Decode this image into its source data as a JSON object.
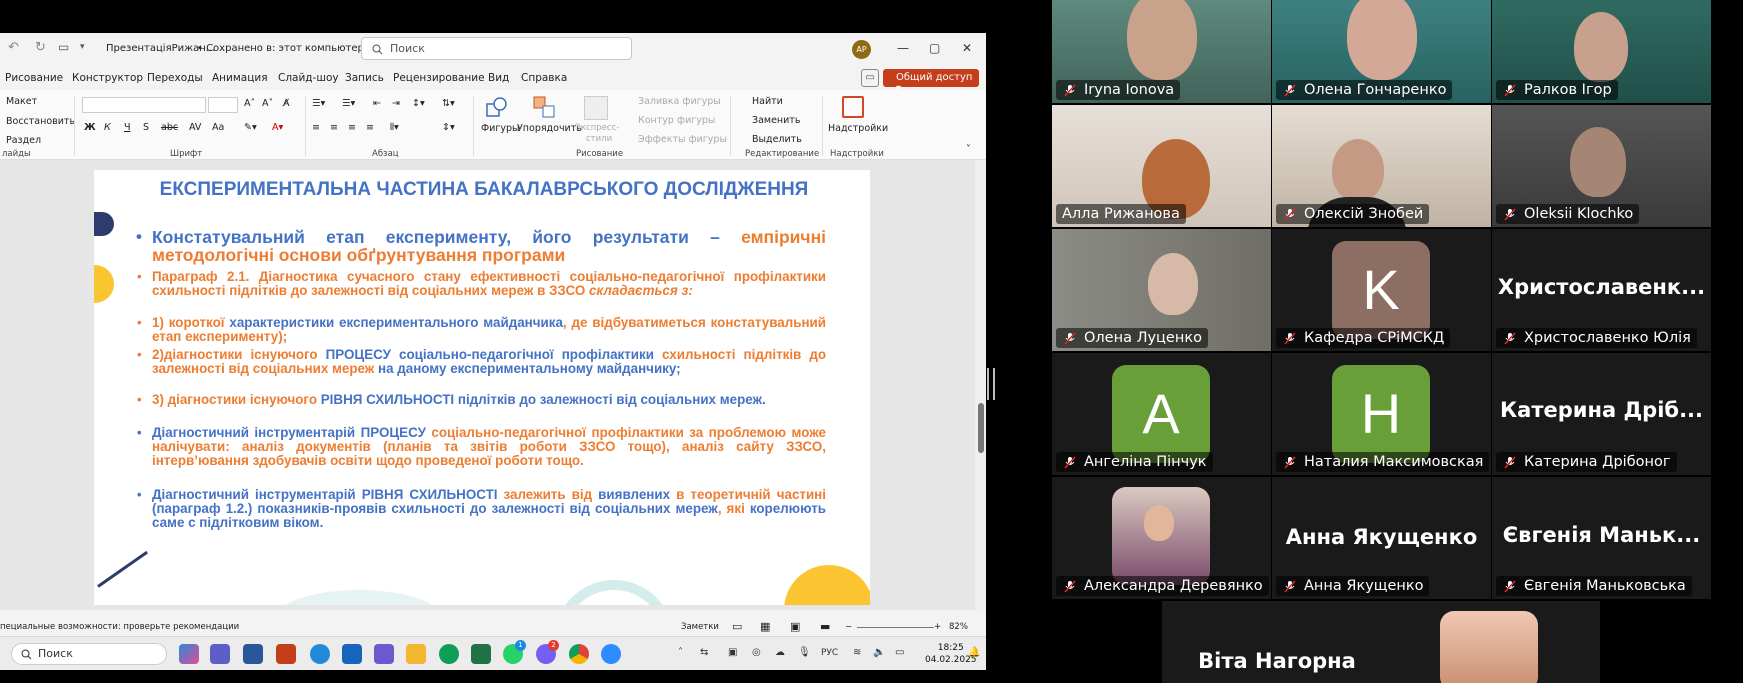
{
  "ppt": {
    "file_title": "ПрезентаціяРижан...",
    "save_status": "• Сохранено в: этот компьютер",
    "search_placeholder": "Поиск",
    "avatar_initials": "АР",
    "menu": [
      "Рисование",
      "Конструктор",
      "Переходы",
      "Анимация",
      "Слайд-шоу",
      "Запись",
      "Рецензирование",
      "Вид",
      "Справка"
    ],
    "share_label": "Общий доступ",
    "ribbon": {
      "layout": "Макет",
      "reset": "Восстановить",
      "section": "Раздел",
      "slides_group": "лайды",
      "font_group": "Шрифт",
      "paragraph_group": "Абзац",
      "shapes": "Фигуры",
      "arrange": "Упорядочить",
      "express_styles_1": "Экспресс-",
      "express_styles_2": "стили",
      "shape_fill": "Заливка фигуры",
      "shape_outline": "Контур фигуры",
      "shape_effects": "Эффекты фигуры",
      "drawing_group": "Рисование",
      "find": "Найти",
      "replace": "Заменить",
      "select": "Выделить",
      "editing_group": "Редактирование",
      "addins": "Надстройки",
      "addins_group": "Надстройки"
    },
    "slide": {
      "title": "ЕКСПЕРИМЕНТАЛЬНА ЧАСТИНА БАКАЛАВРСЬКОГО ДОСЛІДЖЕННЯ",
      "main_blue": "Констатувальний етап експерименту, його результати – ",
      "main_orange": "емпіричні методологічні основи обґрунтування програми",
      "p1_text": "Параграф 2.1. Діагностика сучасного стану ефективності соціально-педагогічної профілактики схильності підлітків до залежності від соціальних мереж в ЗЗСО ",
      "p1_italic": "складається з:",
      "p2_a": "1) короткої ",
      "p2_b": "характеристики експериментального майданчика",
      "p2_c": ", де відбуватиметься констатувальний етап експерименту);",
      "p3_a": "2)діагностики існуючого ",
      "p3_b": "ПРОЦЕСУ соціально-педагогічної профілактики ",
      "p3_c": "схильності підлітків до залежності від соціальних мереж ",
      "p3_d": "на даному експериментальному майданчику;",
      "p4_a": "3) діагностики існуючого ",
      "p4_b": "РІВНЯ СХИЛЬНОСТІ підлітків до залежності від соціальних мереж.",
      "p5_a": "Діагностичний інструментарій ПРОЦЕСУ ",
      "p5_b": "соціально-педагогічної профілактики за проблемою може налічувати: аналіз документів (планів та звітів роботи ЗЗСО тощо), аналіз сайту ЗЗСО, інтерв’ювання здобувачів освіти щодо проведеної роботи тощо.",
      "p6_a": "Діагностичний інструментарій РІВНЯ СХИЛЬНОСТІ ",
      "p6_b": "залежить від ",
      "p6_c": "виявлених ",
      "p6_d": "в теоретичній частині ",
      "p6_e": "(параграф 1.2.) показників-проявів схильності до залежності від соціальних мереж",
      "p6_f": ", які ",
      "p6_g": "корелюють саме с підлітковим віком."
    },
    "status": {
      "accessibility": "пециальные возможности: проверьте рекомендации",
      "notes": "Заметки",
      "zoom": "82%"
    },
    "taskbar": {
      "search": "Поиск",
      "lang": "РУС",
      "time": "18:25",
      "date": "04.02.2025",
      "badge_1": "1",
      "badge_2": "2"
    }
  },
  "participants": [
    {
      "name": "Iryna Ionova"
    },
    {
      "name": "Олена Гончаренко"
    },
    {
      "name": "Ралков Ігор"
    },
    {
      "name": "Алла Рижанова"
    },
    {
      "name": "Олексій Знобей"
    },
    {
      "name": "Oleksii Klochko"
    },
    {
      "name": "Олена Луценко"
    },
    {
      "name": "Кафедра СРіМСКД",
      "letter": "K",
      "color": "#8d6e63"
    },
    {
      "name": "Христославенко Юлія",
      "big": "Христославенк..."
    },
    {
      "name": "Ангеліна Пінчук",
      "letter": "A",
      "color": "#689f38"
    },
    {
      "name": "Наталия Максимовская",
      "letter": "H",
      "color": "#689f38"
    },
    {
      "name": "Катерина Дрібоног",
      "big": "Катерина Дріб..."
    },
    {
      "name": "Александра Деревянко"
    },
    {
      "name": "Анна Якущенко",
      "big": "Анна Якущенко"
    },
    {
      "name": "Євгенія Маньковська",
      "big": "Євгенія Маньк..."
    },
    {
      "big": "Віта Нагорна"
    }
  ]
}
